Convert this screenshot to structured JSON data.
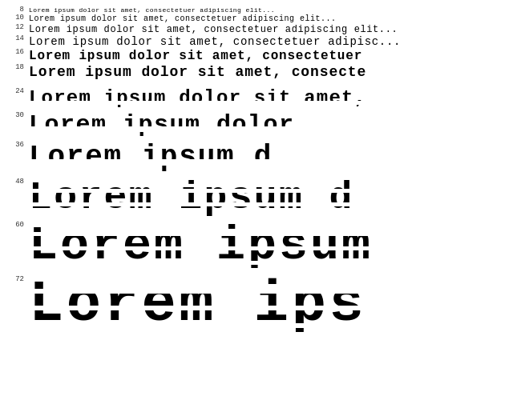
{
  "lines": [
    {
      "num": "8",
      "size": "size-8",
      "text": "Lorem ipsum dolor sit amet, consectetuer adipiscing elit...",
      "striped": false
    },
    {
      "num": "10",
      "size": "size-10",
      "text": "Lorem ipsum dolor sit amet, consectetuer adipiscing elit...",
      "striped": false
    },
    {
      "num": "12",
      "size": "size-12",
      "text": "Lorem ipsum dolor sit amet, consectetuer adipiscing elit...",
      "striped": false
    },
    {
      "num": "14",
      "size": "size-14",
      "text": "Lorem ipsum dolor sit amet, consectetuer adipisc...",
      "striped": false
    },
    {
      "num": "16",
      "size": "size-16",
      "text": "Lorem ipsum dolor sit amet, consectetuer",
      "striped": false
    },
    {
      "num": "18",
      "size": "size-18",
      "text": "Lorem ipsum dolor sit amet, consecte",
      "striped": false
    },
    {
      "num": "24",
      "size": "size-24",
      "text": "Lorem ipsum dolor sit amet,",
      "striped": "light"
    },
    {
      "num": "30",
      "size": "size-30",
      "text": "Lorem ipsum dolor",
      "striped": "medium"
    },
    {
      "num": "36",
      "size": "size-36",
      "text": "Lorem ipsum d",
      "striped": "medium"
    },
    {
      "num": "48",
      "size": "size-48",
      "text": "Lorem ipsum d",
      "striped": "heavy"
    },
    {
      "num": "60",
      "size": "size-60",
      "text": "Lorem ipsum",
      "striped": "ultra"
    },
    {
      "num": "72",
      "size": "size-72",
      "text": "Lorem ips",
      "striped": "ultra"
    }
  ]
}
